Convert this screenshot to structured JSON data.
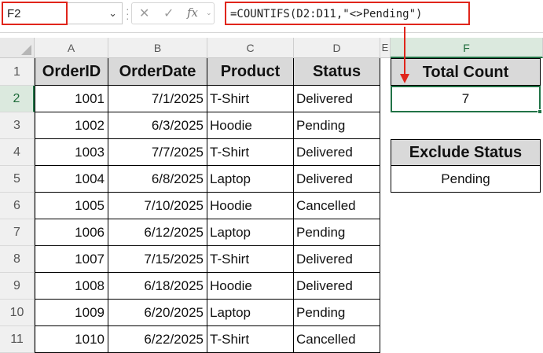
{
  "formula_bar": {
    "name_box": "F2",
    "formula": "=COUNTIFS(D2:D11,\"<>Pending\")"
  },
  "icons": {
    "name_box_dropdown": "chevron-down-icon",
    "cancel": "close-icon",
    "confirm": "checkmark-icon",
    "function": "fx-icon"
  },
  "columns": [
    "A",
    "B",
    "C",
    "D",
    "E",
    "F"
  ],
  "rows": [
    "1",
    "2",
    "3",
    "4",
    "5",
    "6",
    "7",
    "8",
    "9",
    "10",
    "11"
  ],
  "table": {
    "headers": [
      "OrderID",
      "OrderDate",
      "Product",
      "Status"
    ],
    "rows": [
      [
        "1001",
        "7/1/2025",
        "T-Shirt",
        "Delivered"
      ],
      [
        "1002",
        "6/3/2025",
        "Hoodie",
        "Pending"
      ],
      [
        "1003",
        "7/7/2025",
        "T-Shirt",
        "Delivered"
      ],
      [
        "1004",
        "6/8/2025",
        "Laptop",
        "Delivered"
      ],
      [
        "1005",
        "7/10/2025",
        "Hoodie",
        "Cancelled"
      ],
      [
        "1006",
        "6/12/2025",
        "Laptop",
        "Pending"
      ],
      [
        "1007",
        "7/15/2025",
        "T-Shirt",
        "Delivered"
      ],
      [
        "1008",
        "6/18/2025",
        "Hoodie",
        "Delivered"
      ],
      [
        "1009",
        "6/20/2025",
        "Laptop",
        "Pending"
      ],
      [
        "1010",
        "6/22/2025",
        "T-Shirt",
        "Cancelled"
      ]
    ]
  },
  "result": {
    "header": "Total Count",
    "value": "7"
  },
  "criteria": {
    "header": "Exclude Status",
    "value": "Pending"
  },
  "colors": {
    "highlight_border": "#e0251b",
    "selection": "#217346",
    "header_fill": "#d9d9d9"
  }
}
